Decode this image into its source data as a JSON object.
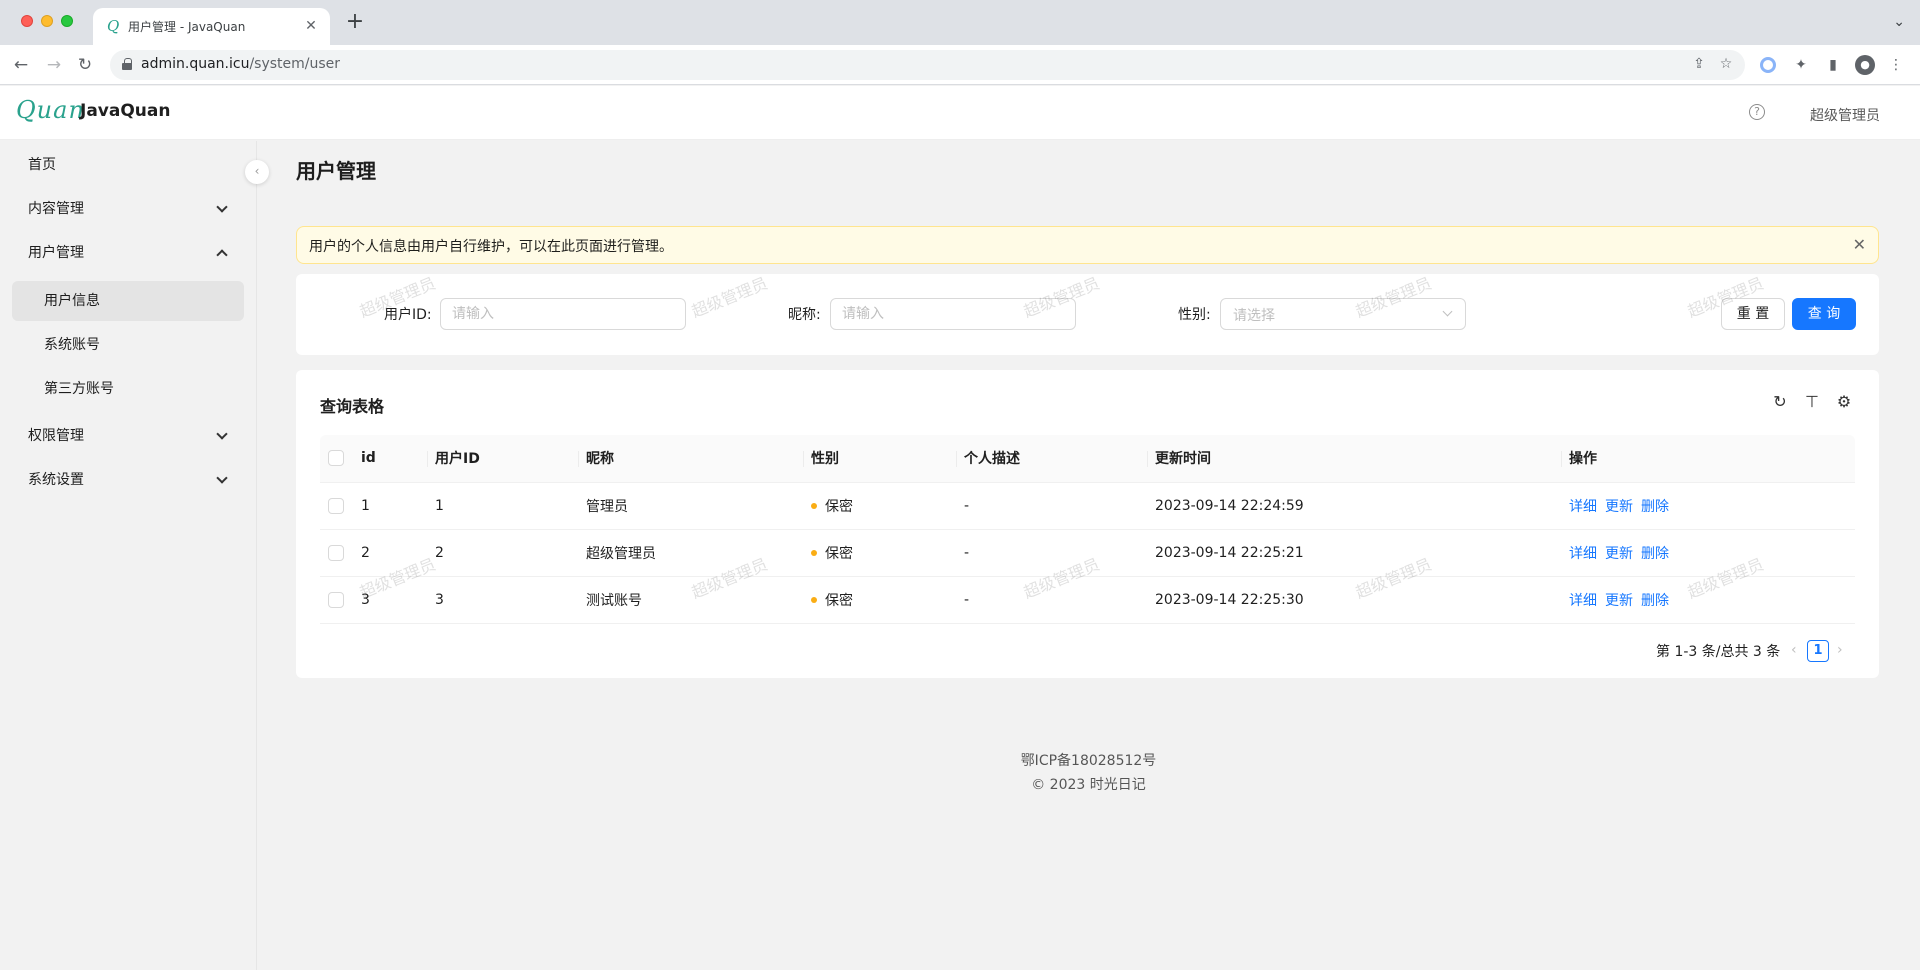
{
  "browser": {
    "tab_title": "用户管理 - JavaQuan",
    "tab_close": "✕",
    "new_tab": "+",
    "url_host": "admin.quan.icu",
    "url_path": "/system/user"
  },
  "header": {
    "logo_text": "Quan",
    "app_name": "JavaQuan",
    "help": "?",
    "user_name": "超级管理员"
  },
  "sidebar": {
    "items": [
      {
        "label": "首页"
      },
      {
        "label": "内容管理"
      },
      {
        "label": "用户管理"
      },
      {
        "label": "用户信息"
      },
      {
        "label": "系统账号"
      },
      {
        "label": "第三方账号"
      },
      {
        "label": "权限管理"
      },
      {
        "label": "系统设置"
      }
    ]
  },
  "page": {
    "title": "用户管理",
    "alert": "用户的个人信息由用户自行维护，可以在此页面进行管理。"
  },
  "search": {
    "user_id_label": "用户ID",
    "user_id_placeholder": "请输入",
    "nickname_label": "昵称",
    "nickname_placeholder": "请输入",
    "gender_label": "性别",
    "gender_placeholder": "请选择",
    "reset_label": "重 置",
    "query_label": "查 询"
  },
  "watermark": "超级管理员",
  "table": {
    "title": "查询表格",
    "columns": [
      "id",
      "用户ID",
      "昵称",
      "性别",
      "个人描述",
      "更新时间",
      "操作"
    ],
    "rows": [
      {
        "id": "1",
        "user_id": "1",
        "nickname": "管理员",
        "gender": "保密",
        "desc": "-",
        "updated": "2023-09-14 22:24:59"
      },
      {
        "id": "2",
        "user_id": "2",
        "nickname": "超级管理员",
        "gender": "保密",
        "desc": "-",
        "updated": "2023-09-14 22:25:21"
      },
      {
        "id": "3",
        "user_id": "3",
        "nickname": "测试账号",
        "gender": "保密",
        "desc": "-",
        "updated": "2023-09-14 22:25:30"
      }
    ],
    "actions": {
      "detail": "详细",
      "update": "更新",
      "delete": "删除"
    },
    "pagination": {
      "total_text": "第 1-3 条/总共 3 条",
      "current_page": "1"
    }
  },
  "footer": {
    "icp": "鄂ICP备18028512号",
    "copyright": "© 2023 时光日记"
  },
  "colors": {
    "primary": "#1677ff",
    "brand": "#2aa28d",
    "alert_bg": "#fffbe6",
    "status_dot": "#faad14"
  },
  "icons": [
    "back-icon",
    "forward-icon",
    "reload-icon",
    "lock-icon",
    "share-icon",
    "star-icon",
    "extension-icon",
    "puzzle-icon",
    "sidepanel-icon",
    "profile-icon",
    "menu-icon",
    "help-icon",
    "reload-table-icon",
    "density-icon",
    "settings-icon"
  ]
}
